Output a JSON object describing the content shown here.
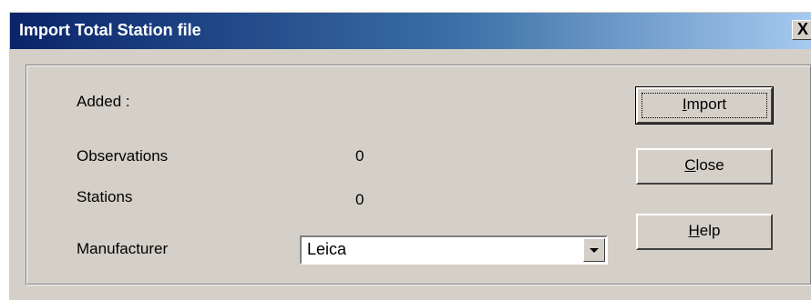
{
  "window": {
    "title": "Import Total Station file",
    "close_glyph": "X"
  },
  "fields": {
    "added_label": "Added :",
    "observations_label": "Observations",
    "observations_value": "0",
    "stations_label": "Stations",
    "stations_value": "0",
    "manufacturer_label": "Manufacturer",
    "manufacturer_value": "Leica"
  },
  "buttons": {
    "import": {
      "mnemonic": "I",
      "rest": "mport"
    },
    "close": {
      "mnemonic": "C",
      "rest": "lose"
    },
    "help": {
      "mnemonic": "H",
      "rest": "elp"
    }
  },
  "colors": {
    "titlebar_start": "#0a246a",
    "titlebar_end": "#a6caf0",
    "dialog_bg": "#d4d0c8"
  }
}
